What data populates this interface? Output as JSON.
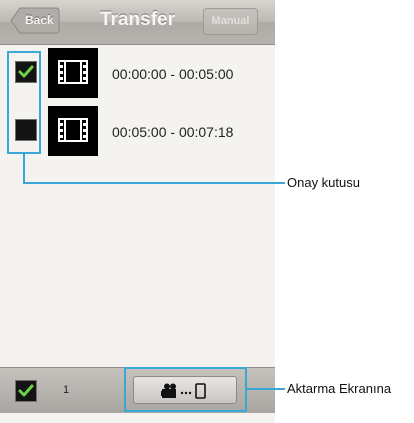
{
  "navbar": {
    "back_label": "Back",
    "title": "Transfer",
    "manual_label": "Manual"
  },
  "rows": [
    {
      "range": "00:00:00 - 00:05:00",
      "checked": true
    },
    {
      "range": "00:05:00 - 00:07:18",
      "checked": false
    }
  ],
  "toolbar": {
    "select_all_checked": true,
    "selected_count": "1",
    "transfer_icon": "camera-to-phone-icon"
  },
  "annotations": {
    "checkbox_label": "Onay kutusu",
    "transfer_label": "Aktarma Ekranına"
  },
  "colors": {
    "callout": "#3aa7d6",
    "check": "#6fd14a"
  }
}
